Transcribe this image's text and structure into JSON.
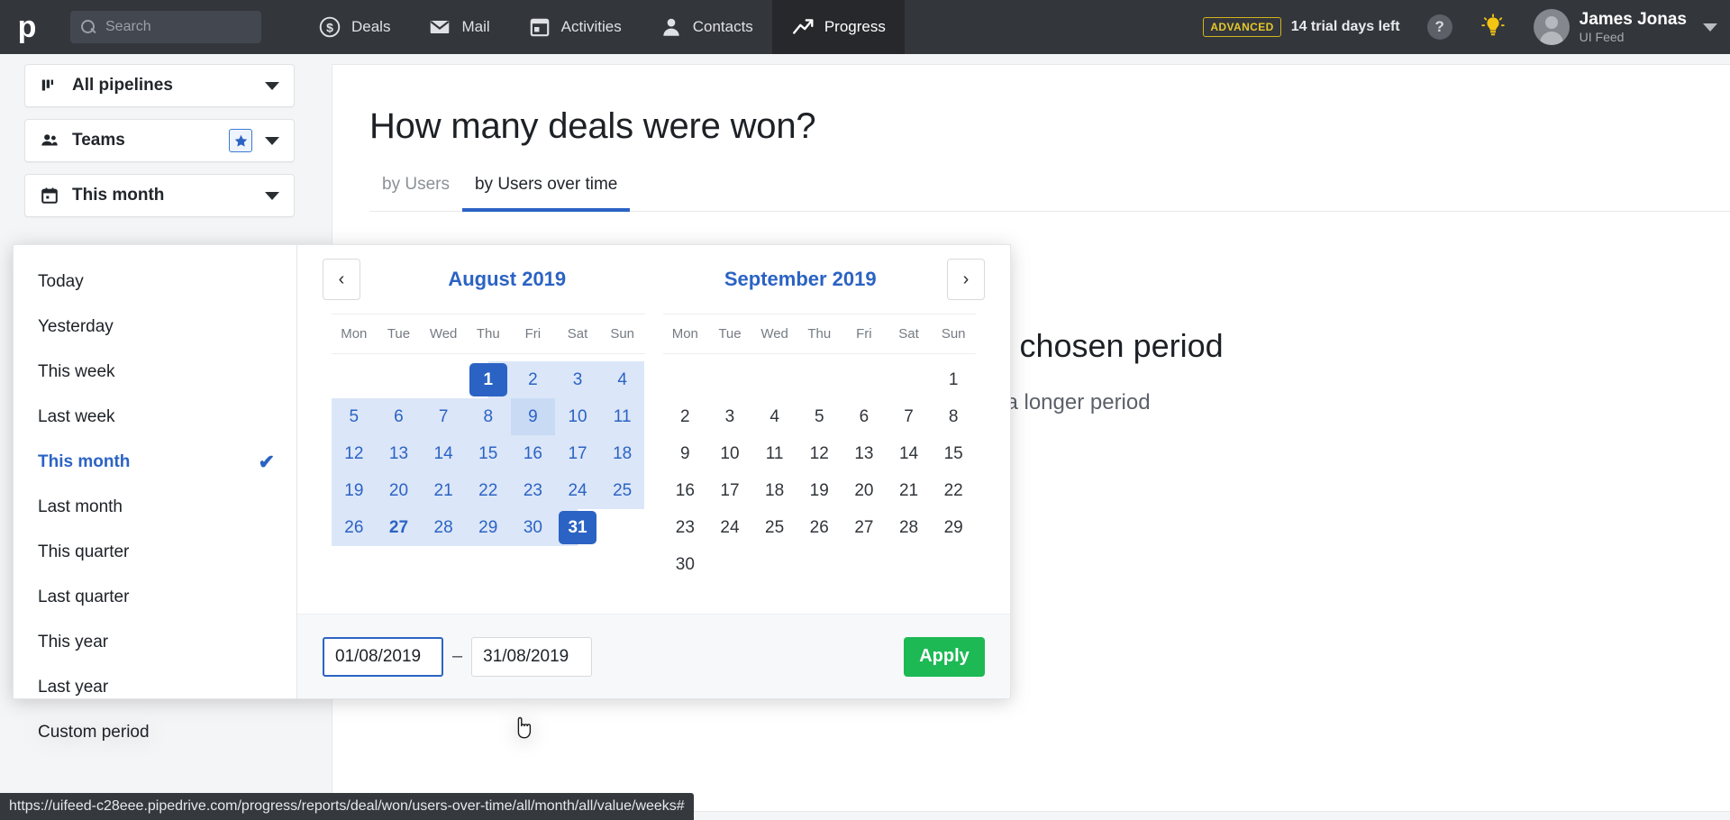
{
  "topnav": {
    "logo": "p",
    "search_placeholder": "Search",
    "items": [
      {
        "label": "Deals",
        "icon": "dollar-circle-icon",
        "active": false
      },
      {
        "label": "Mail",
        "icon": "envelope-icon",
        "active": false
      },
      {
        "label": "Activities",
        "icon": "calendar-icon",
        "active": false
      },
      {
        "label": "Contacts",
        "icon": "person-icon",
        "active": false
      },
      {
        "label": "Progress",
        "icon": "trend-up-icon",
        "active": true
      }
    ],
    "plan_badge": "ADVANCED",
    "trial_text": "14 trial days left",
    "help_glyph": "?",
    "user_name": "James Jonas",
    "user_company": "UI Feed"
  },
  "filters": [
    {
      "label": "All pipelines",
      "icon": "pipeline-icon",
      "starred": false
    },
    {
      "label": "Teams",
      "icon": "people-icon",
      "starred": true
    },
    {
      "label": "This month",
      "icon": "calendar-icon",
      "starred": false
    }
  ],
  "main": {
    "title": "How many deals were won?",
    "tabs": [
      {
        "label": "by Users",
        "active": false
      },
      {
        "label": "by Users over time",
        "active": true
      }
    ],
    "placeholder_line1": "d during the chosen period",
    "placeholder_line2": "ipeline or a longer period"
  },
  "date_dropdown": {
    "presets": [
      {
        "label": "Today",
        "selected": false
      },
      {
        "label": "Yesterday",
        "selected": false
      },
      {
        "label": "This week",
        "selected": false
      },
      {
        "label": "Last week",
        "selected": false
      },
      {
        "label": "This month",
        "selected": true
      },
      {
        "label": "Last month",
        "selected": false
      },
      {
        "label": "This quarter",
        "selected": false
      },
      {
        "label": "Last quarter",
        "selected": false
      },
      {
        "label": "This year",
        "selected": false
      },
      {
        "label": "Last year",
        "selected": false
      },
      {
        "label": "Custom period",
        "selected": false
      }
    ],
    "check_glyph": "✔",
    "prev_glyph": "‹",
    "next_glyph": "›",
    "dow": [
      "Mon",
      "Tue",
      "Wed",
      "Thu",
      "Fri",
      "Sat",
      "Sun"
    ],
    "months": [
      {
        "title": "August 2019",
        "lead_blanks": 3,
        "days": [
          {
            "n": 1,
            "state": "edge-start"
          },
          {
            "n": 2,
            "state": "inrange"
          },
          {
            "n": 3,
            "state": "inrange"
          },
          {
            "n": 4,
            "state": "inrange"
          },
          {
            "n": 5,
            "state": "inrange"
          },
          {
            "n": 6,
            "state": "inrange"
          },
          {
            "n": 7,
            "state": "inrange"
          },
          {
            "n": 8,
            "state": "inrange"
          },
          {
            "n": 9,
            "state": "inrange-hover"
          },
          {
            "n": 10,
            "state": "inrange"
          },
          {
            "n": 11,
            "state": "inrange"
          },
          {
            "n": 12,
            "state": "inrange"
          },
          {
            "n": 13,
            "state": "inrange"
          },
          {
            "n": 14,
            "state": "inrange"
          },
          {
            "n": 15,
            "state": "inrange"
          },
          {
            "n": 16,
            "state": "inrange"
          },
          {
            "n": 17,
            "state": "inrange"
          },
          {
            "n": 18,
            "state": "inrange"
          },
          {
            "n": 19,
            "state": "inrange"
          },
          {
            "n": 20,
            "state": "inrange"
          },
          {
            "n": 21,
            "state": "inrange"
          },
          {
            "n": 22,
            "state": "inrange"
          },
          {
            "n": 23,
            "state": "inrange"
          },
          {
            "n": 24,
            "state": "inrange"
          },
          {
            "n": 25,
            "state": "inrange"
          },
          {
            "n": 26,
            "state": "inrange"
          },
          {
            "n": 27,
            "state": "inrange-today"
          },
          {
            "n": 28,
            "state": "inrange"
          },
          {
            "n": 29,
            "state": "inrange"
          },
          {
            "n": 30,
            "state": "inrange"
          },
          {
            "n": 31,
            "state": "edge-end"
          }
        ]
      },
      {
        "title": "September 2019",
        "lead_blanks": 6,
        "days": [
          {
            "n": 1,
            "state": "normal"
          },
          {
            "n": 2,
            "state": "normal"
          },
          {
            "n": 3,
            "state": "normal"
          },
          {
            "n": 4,
            "state": "normal"
          },
          {
            "n": 5,
            "state": "normal"
          },
          {
            "n": 6,
            "state": "normal"
          },
          {
            "n": 7,
            "state": "normal"
          },
          {
            "n": 8,
            "state": "normal"
          },
          {
            "n": 9,
            "state": "normal"
          },
          {
            "n": 10,
            "state": "normal"
          },
          {
            "n": 11,
            "state": "normal"
          },
          {
            "n": 12,
            "state": "normal"
          },
          {
            "n": 13,
            "state": "normal"
          },
          {
            "n": 14,
            "state": "normal"
          },
          {
            "n": 15,
            "state": "normal"
          },
          {
            "n": 16,
            "state": "normal"
          },
          {
            "n": 17,
            "state": "normal"
          },
          {
            "n": 18,
            "state": "normal"
          },
          {
            "n": 19,
            "state": "normal"
          },
          {
            "n": 20,
            "state": "normal"
          },
          {
            "n": 21,
            "state": "normal"
          },
          {
            "n": 22,
            "state": "normal"
          },
          {
            "n": 23,
            "state": "normal"
          },
          {
            "n": 24,
            "state": "normal"
          },
          {
            "n": 25,
            "state": "normal"
          },
          {
            "n": 26,
            "state": "normal"
          },
          {
            "n": 27,
            "state": "normal"
          },
          {
            "n": 28,
            "state": "normal"
          },
          {
            "n": 29,
            "state": "normal"
          },
          {
            "n": 30,
            "state": "normal"
          }
        ]
      }
    ],
    "start_date": "01/08/2019",
    "end_date": "31/08/2019",
    "range_separator": "–",
    "apply_label": "Apply"
  },
  "statusbar": {
    "url": "https://uifeed-c28eee.pipedrive.com/progress/reports/deal/won/users-over-time/all/month/all/value/weeks#"
  },
  "colors": {
    "nav_bg": "#33363b",
    "nav_active_bg": "#26282c",
    "accent_blue": "#2b63c4",
    "range_fill": "#dbe6f8",
    "apply_green": "#1db954",
    "badge_yellow": "#e3c72c"
  }
}
